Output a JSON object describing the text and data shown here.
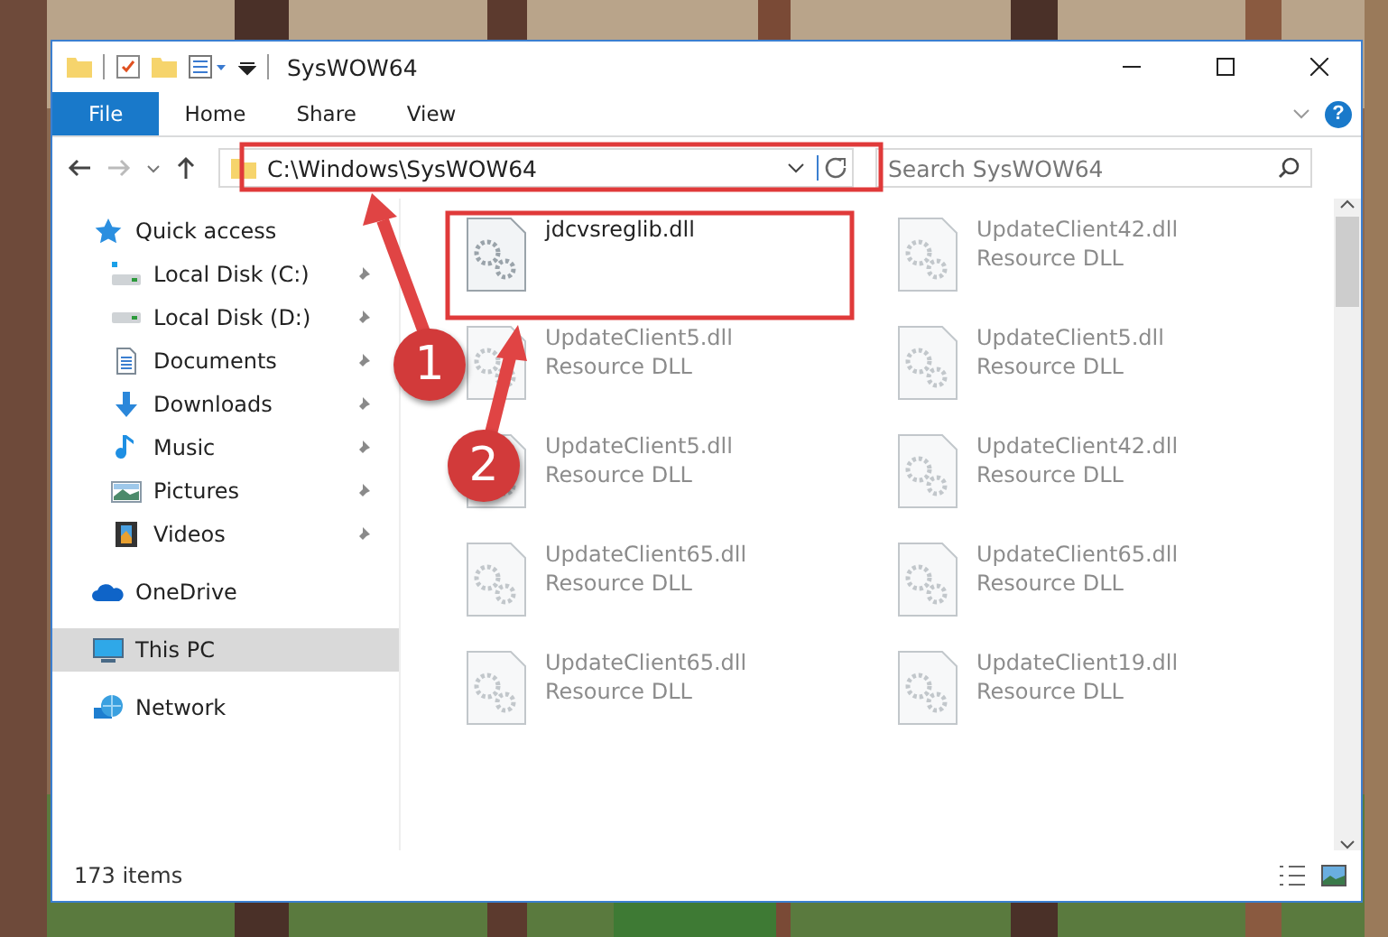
{
  "window": {
    "title": "SysWOW64",
    "help_label": "?"
  },
  "ribbon_tabs": [
    {
      "label": "File",
      "selected": true
    },
    {
      "label": "Home",
      "selected": false
    },
    {
      "label": "Share",
      "selected": false
    },
    {
      "label": "View",
      "selected": false
    }
  ],
  "address_bar": {
    "path": "C:\\Windows\\SysWOW64"
  },
  "search": {
    "placeholder": "Search SysWOW64"
  },
  "sidebar": {
    "items": [
      {
        "label": "Quick access",
        "kind": "star",
        "selected": false,
        "children": [
          {
            "label": "Local Disk (C:)",
            "kind": "drive-c",
            "pinned": true,
            "selected": false
          },
          {
            "label": "Local Disk (D:)",
            "kind": "drive",
            "pinned": true,
            "selected": false
          },
          {
            "label": "Documents",
            "kind": "documents",
            "pinned": true,
            "selected": false
          },
          {
            "label": "Downloads",
            "kind": "downloads",
            "pinned": true,
            "selected": false
          },
          {
            "label": "Music",
            "kind": "music",
            "pinned": true,
            "selected": false
          },
          {
            "label": "Pictures",
            "kind": "pictures",
            "pinned": true,
            "selected": false
          },
          {
            "label": "Videos",
            "kind": "videos",
            "pinned": true,
            "selected": false
          }
        ]
      },
      {
        "label": "OneDrive",
        "kind": "cloud",
        "selected": false
      },
      {
        "label": "This PC",
        "kind": "pc",
        "selected": true
      },
      {
        "label": "Network",
        "kind": "network",
        "selected": false
      }
    ]
  },
  "files": [
    {
      "name": "jdcvsreglib.dll",
      "blurred": false
    },
    {
      "name": "UpdateClient42.dll",
      "type": "Resource DLL",
      "blurred": true
    },
    {
      "name": "UpdateClient5.dll",
      "type": "Resource DLL",
      "blurred": true
    },
    {
      "name": "UpdateClient5.dll",
      "type": "Resource DLL",
      "blurred": true
    },
    {
      "name": "UpdateClient5.dll",
      "type": "Resource DLL",
      "blurred": true
    },
    {
      "name": "UpdateClient42.dll",
      "type": "Resource DLL",
      "blurred": true
    },
    {
      "name": "UpdateClient65.dll",
      "type": "Resource DLL",
      "blurred": true
    },
    {
      "name": "UpdateClient65.dll",
      "type": "Resource DLL",
      "blurred": true
    },
    {
      "name": "UpdateClient65.dll",
      "type": "Resource DLL",
      "blurred": true
    },
    {
      "name": "UpdateClient19.dll",
      "type": "Resource DLL",
      "blurred": true
    }
  ],
  "status_bar": {
    "count": "173 items"
  },
  "annotations": [
    {
      "number": "1"
    },
    {
      "number": "2"
    }
  ]
}
